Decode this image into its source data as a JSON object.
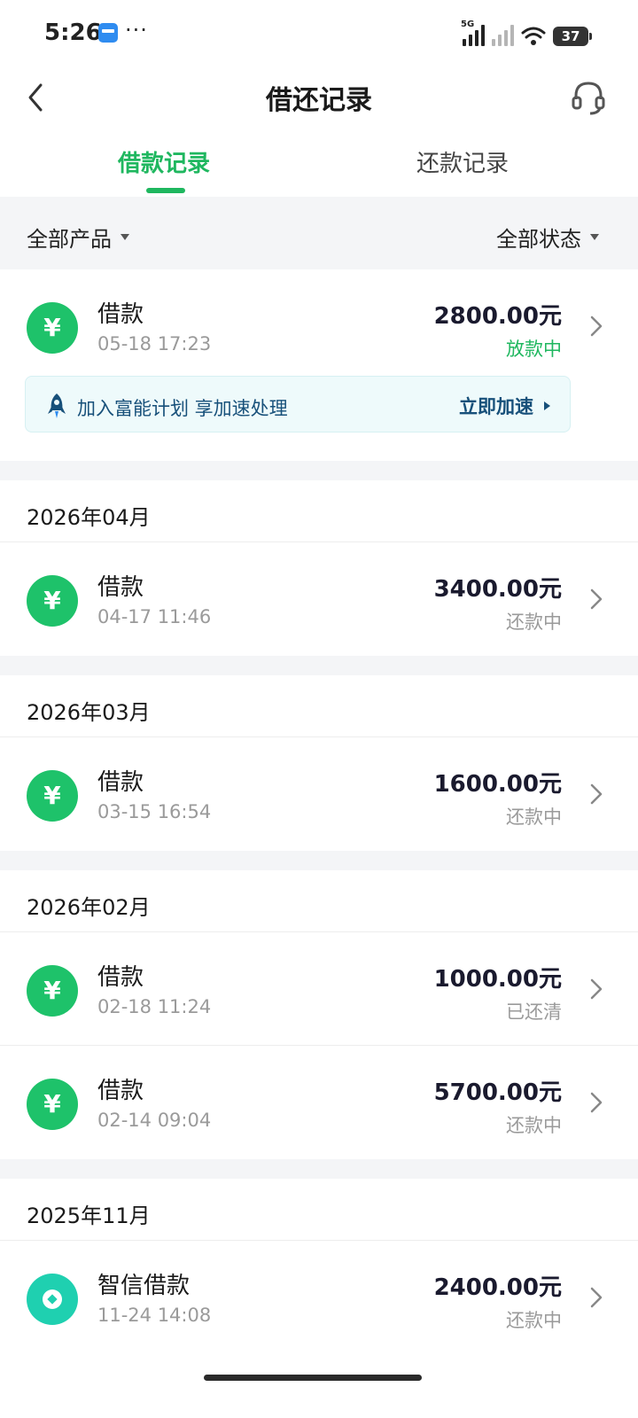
{
  "status_bar": {
    "time": "5:26",
    "dots": "···",
    "network_label": "5G",
    "battery": "37"
  },
  "header": {
    "title": "借还记录"
  },
  "tabs": [
    {
      "label": "借款记录",
      "active": true
    },
    {
      "label": "还款记录",
      "active": false
    }
  ],
  "filters": {
    "product": "全部产品",
    "status": "全部状态"
  },
  "pending_record": {
    "name": "借款",
    "date": "05-18 17:23",
    "amount": "2800.00元",
    "status": "放款中"
  },
  "promo": {
    "text": "加入富能计划 享加速处理",
    "button": "立即加速"
  },
  "groups": [
    {
      "month": "2026年04月",
      "records": [
        {
          "name": "借款",
          "date": "04-17 11:46",
          "amount": "3400.00元",
          "status": "还款中"
        }
      ]
    },
    {
      "month": "2026年03月",
      "records": [
        {
          "name": "借款",
          "date": "03-15 16:54",
          "amount": "1600.00元",
          "status": "还款中"
        }
      ]
    },
    {
      "month": "2026年02月",
      "records": [
        {
          "name": "借款",
          "date": "02-18 11:24",
          "amount": "1000.00元",
          "status": "已还清"
        },
        {
          "name": "借款",
          "date": "02-14 09:04",
          "amount": "5700.00元",
          "status": "还款中"
        }
      ]
    },
    {
      "month": "2025年11月",
      "records": [
        {
          "name": "智信借款",
          "date": "11-24 14:08",
          "amount": "2400.00元",
          "status": "还款中"
        }
      ]
    }
  ],
  "icons": {
    "yuan_icon": "¥",
    "colors": {
      "accent_green": "#1fb75f",
      "icon_green": "#1ec26a",
      "icon_teal": "#1fd0b0",
      "promo_text": "#17507a"
    }
  }
}
